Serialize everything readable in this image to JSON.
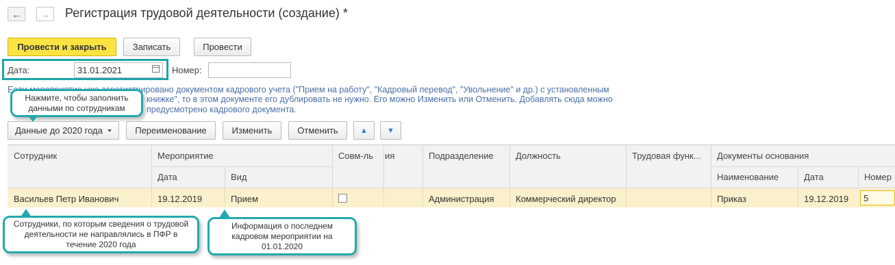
{
  "window": {
    "title": "Регистрация трудовой деятельности (создание) *",
    "back_icon": "←",
    "forward_icon": "→"
  },
  "toolbar": {
    "post_close_label": "Провести и закрыть",
    "save_label": "Записать",
    "post_label": "Провести"
  },
  "form": {
    "date_label": "Дата:",
    "date_value": "31.01.2021",
    "number_label": "Номер:",
    "number_value": ""
  },
  "hint": {
    "line1": "Если мероприятие уже зарегистрировано документом кадрового учета (\"Прием на работу\", \"Кадровый перевод\", \"Увольнение\" и др.) с установленным",
    "line2": "книжке\", то в этом документе его дублировать не нужно. Его можно Изменить или Отменить. Добавлять сюда можно",
    "line3": "предусмотрено кадрового документа."
  },
  "callouts": {
    "fill_data": "Нажмите, чтобы заполнить данными по сотрудникам",
    "employees": "Сотрудники, по которым сведения о трудовой деятельности не направлялись в ПФР в течение 2020 года",
    "last_event": "Информация о последнем кадровом мероприятии на 01.01.2020"
  },
  "actions": {
    "data_before_2020": "Данные до 2020 года",
    "rename": "Переименование",
    "change": "Изменить",
    "cancel": "Отменить",
    "up_icon": "▲",
    "down_icon": "▼"
  },
  "table": {
    "headers": {
      "employee": "Сотрудник",
      "event": "Мероприятие",
      "event_date": "Дата",
      "event_kind": "Вид",
      "combo": "Совм-ль",
      "hidden_col": "ия",
      "department": "Подразделение",
      "position": "Должность",
      "labor_function": "Трудовая функ...",
      "base_docs": "Документы основания",
      "doc_name": "Наименование",
      "doc_date": "Дата",
      "doc_number": "Номер"
    },
    "rows": [
      {
        "employee": "Васильев Петр Иванович",
        "event_date": "19.12.2019",
        "event_kind": "Прием",
        "combo": false,
        "department": "Администрация",
        "position": "Коммерческий директор",
        "labor_function": "",
        "doc_name": "Приказ",
        "doc_date": "19.12.2019",
        "doc_number": "5"
      }
    ]
  }
}
